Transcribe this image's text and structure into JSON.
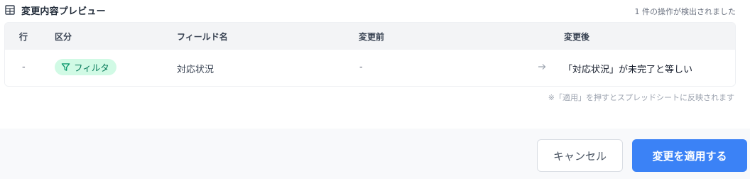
{
  "header": {
    "title": "変更内容プレビュー",
    "detected": "1 件の操作が検出されました"
  },
  "table": {
    "columns": [
      "行",
      "区分",
      "フィールド名",
      "変更前",
      "変更後"
    ],
    "rows": [
      {
        "row": "-",
        "category": "フィルタ",
        "field": "対応状況",
        "before": "-",
        "after": "「対応状況」が未完了と等しい"
      }
    ]
  },
  "note": "※「適用」を押すとスプレッドシートに反映されます",
  "footer": {
    "cancel_label": "キャンセル",
    "apply_label": "変更を適用する"
  },
  "icons": {
    "header": "table-icon",
    "category": "filter-icon",
    "change": "arrow-right-icon"
  },
  "colors": {
    "accent": "#3b82f6",
    "badge_bg": "#d1fae5",
    "badge_text": "#047857"
  }
}
